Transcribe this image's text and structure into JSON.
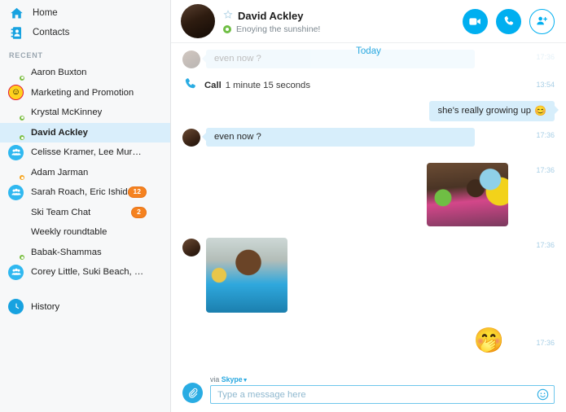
{
  "sidebar": {
    "nav": [
      {
        "label": "Home",
        "icon": "home-icon"
      },
      {
        "label": "Contacts",
        "icon": "contacts-icon"
      }
    ],
    "recent_header": "RECENT",
    "chats": [
      {
        "name": "Aaron Buxton",
        "avatar": "photo",
        "presence": "online",
        "badge": null
      },
      {
        "name": "Marketing and Promotion",
        "avatar": "emoji",
        "presence": null,
        "badge": null
      },
      {
        "name": "Krystal McKinney",
        "avatar": "photo",
        "presence": "online",
        "badge": null
      },
      {
        "name": "David Ackley",
        "avatar": "photo",
        "presence": "online",
        "badge": null,
        "active": true
      },
      {
        "name": "Celisse Kramer, Lee Murphy, MJ...",
        "avatar": "group",
        "presence": null,
        "badge": null
      },
      {
        "name": "Adam Jarman",
        "avatar": "photo",
        "presence": "away",
        "badge": null
      },
      {
        "name": "Sarah Roach, Eric Ishida",
        "avatar": "group",
        "presence": null,
        "badge": "12"
      },
      {
        "name": "Ski Team Chat",
        "avatar": "photo",
        "presence": null,
        "badge": "2"
      },
      {
        "name": "Weekly roundtable",
        "avatar": "photo",
        "presence": null,
        "badge": null
      },
      {
        "name": "Babak-Shammas",
        "avatar": "photo",
        "presence": "online",
        "badge": null
      },
      {
        "name": "Corey Little, Suki Beach, Matthew...",
        "avatar": "group",
        "presence": null,
        "badge": null
      }
    ],
    "history": {
      "label": "History",
      "icon": "clock-icon"
    }
  },
  "header": {
    "name": "David Ackley",
    "mood": "Enoying the sunshine!",
    "favorite_icon": "star-outline-icon",
    "status": "online",
    "actions": [
      {
        "name": "video-call-button",
        "icon": "video-camera-icon"
      },
      {
        "name": "audio-call-button",
        "icon": "phone-icon"
      },
      {
        "name": "add-people-button",
        "icon": "add-person-icon"
      }
    ]
  },
  "conversation": {
    "divider": "Today",
    "messages": [
      {
        "id": "m0",
        "type": "text",
        "dir": "in",
        "text": "even now ?",
        "time": "17:36",
        "faded": true
      },
      {
        "id": "m1",
        "type": "call",
        "label": "Call",
        "duration": "1 minute 15 seconds",
        "time": "13:54"
      },
      {
        "id": "m2",
        "type": "text",
        "dir": "out",
        "text": "she's really growing up",
        "emoji": "😊",
        "time": ""
      },
      {
        "id": "m3",
        "type": "text",
        "dir": "in",
        "text": "even now ?",
        "time": "17:36"
      },
      {
        "id": "m4",
        "type": "photo",
        "dir": "out",
        "caption": "girl-with-balloons-photo",
        "time": "17:36"
      },
      {
        "id": "m5",
        "type": "photo",
        "dir": "in",
        "caption": "boy-with-trophy-photo",
        "time": "17:36"
      },
      {
        "id": "m6",
        "type": "emoji",
        "dir": "out",
        "emoji": "🤭",
        "time": "17:36"
      }
    ]
  },
  "composer": {
    "via_prefix": "via",
    "via_service": "Skype",
    "placeholder": "Type a message here",
    "value": "",
    "attach_icon": "paperclip-icon",
    "emoji_icon": "smiley-icon"
  }
}
